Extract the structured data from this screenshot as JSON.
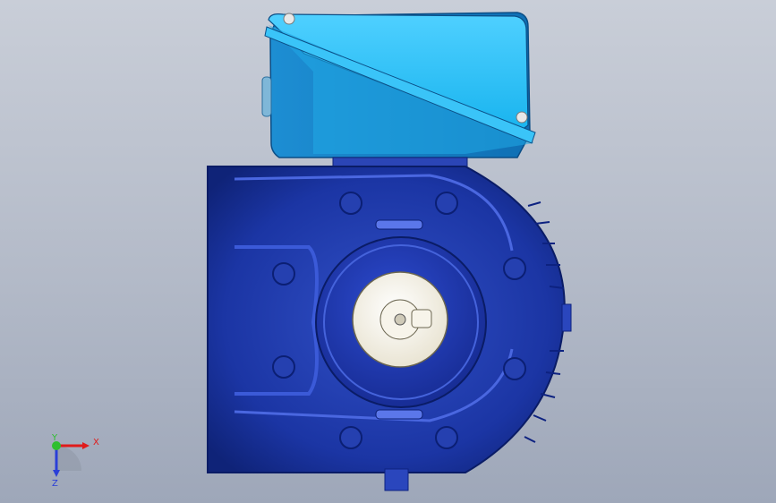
{
  "view": {
    "background_top": "#c9ced8",
    "background_bottom": "#9ea7b9"
  },
  "model": {
    "motor_box_color": "#1ebaf2",
    "pump_body_color": "#1f3fb0",
    "rotor_face_color": "#f4f1e6"
  },
  "triad": {
    "x_label": "X",
    "y_label": "Y",
    "z_label": "Z",
    "x_color": "#e01b1b",
    "y_color": "#2fbf2f",
    "z_color": "#2a3fd8"
  }
}
